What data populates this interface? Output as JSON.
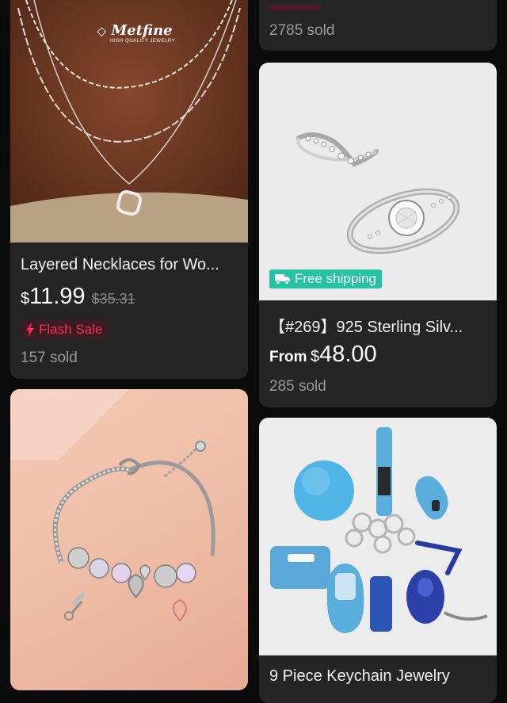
{
  "products": [
    {
      "title": "",
      "price_from": "",
      "currency": "",
      "price": "",
      "original_price": "",
      "badge": "",
      "sold": "2785 sold"
    },
    {
      "title": "Layered Necklaces for Wo...",
      "currency": "$",
      "price": "11.99",
      "original_price": "$35.31",
      "badge": "Flash Sale",
      "sold": "157 sold",
      "image_logo": "Metfine",
      "image_logo_sub": "HIGH QUALITY JEWELRY"
    },
    {
      "title": "【#269】925 Sterling Silv...",
      "price_from": "From",
      "currency": "$",
      "price": "48.00",
      "badge": "Free shipping",
      "sold": "285 sold"
    },
    {
      "title": "",
      "price": "",
      "sold": ""
    },
    {
      "title": "9 Piece Keychain Jewelry",
      "price": "",
      "sold": ""
    }
  ],
  "colors": {
    "background": "#0b0b0b",
    "card": "#252525",
    "flash_sale": "#fe2c55",
    "free_shipping": "#25c2a4"
  },
  "icons": [
    "lightning-icon",
    "truck-icon"
  ]
}
